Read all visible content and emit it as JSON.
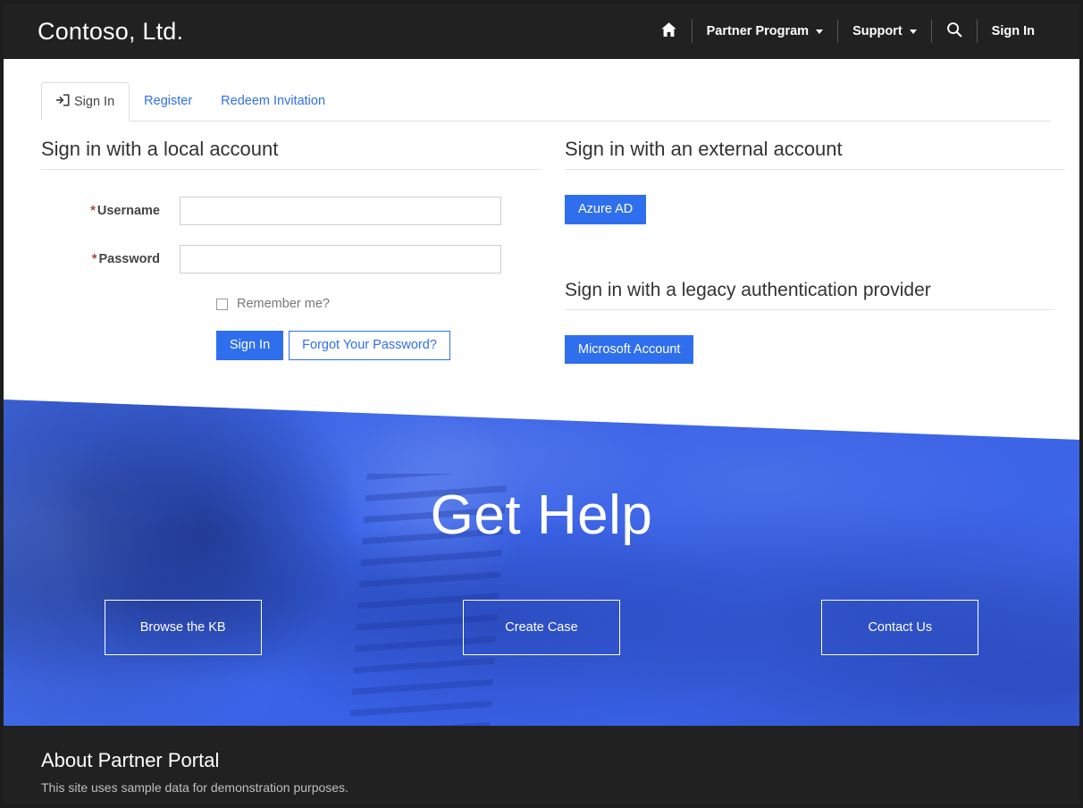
{
  "colors": {
    "brand_blue": "#2f6fed",
    "header_dark": "#212121",
    "hero_blue": "#3a63e8",
    "required_red": "#a94442"
  },
  "header": {
    "brand": "Contoso, Ltd.",
    "home_icon": "home-icon",
    "search_icon": "search-icon",
    "nav": [
      {
        "label": "Partner Program",
        "has_caret": true
      },
      {
        "label": "Support",
        "has_caret": true
      }
    ],
    "sign_in": "Sign In"
  },
  "tabs": [
    {
      "label": "Sign In",
      "icon": "sign-in-icon",
      "active": true
    },
    {
      "label": "Register",
      "active": false
    },
    {
      "label": "Redeem Invitation",
      "active": false
    }
  ],
  "local_account": {
    "title": "Sign in with a local account",
    "username": {
      "label": "Username",
      "required_marker": "*",
      "value": "",
      "placeholder": ""
    },
    "password": {
      "label": "Password",
      "required_marker": "*",
      "value": "",
      "placeholder": ""
    },
    "remember": {
      "label": "Remember me?",
      "checked": false
    },
    "sign_in_button": "Sign In",
    "forgot_button": "Forgot Your Password?"
  },
  "external_account": {
    "title": "Sign in with an external account",
    "providers": [
      "Azure AD"
    ]
  },
  "legacy_account": {
    "title": "Sign in with a legacy authentication provider",
    "providers": [
      "Microsoft Account"
    ]
  },
  "hero": {
    "title": "Get Help",
    "buttons": [
      "Browse the KB",
      "Create Case",
      "Contact Us"
    ]
  },
  "footer": {
    "title": "About Partner Portal",
    "text": "This site uses sample data for demonstration purposes."
  }
}
